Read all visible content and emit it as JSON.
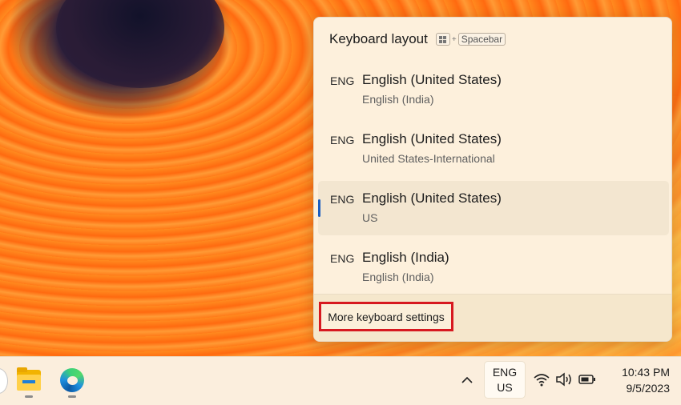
{
  "flyout": {
    "title": "Keyboard layout",
    "shortcut_plus": "+",
    "shortcut_key": "Spacebar",
    "layouts": [
      {
        "code": "ENG",
        "name": "English (United States)",
        "sub": "English (India)",
        "selected": false
      },
      {
        "code": "ENG",
        "name": "English (United States)",
        "sub": "United States-International",
        "selected": false
      },
      {
        "code": "ENG",
        "name": "English (United States)",
        "sub": "US",
        "selected": true
      },
      {
        "code": "ENG",
        "name": "English (India)",
        "sub": "English (India)",
        "selected": false
      }
    ],
    "more_settings_label": "More keyboard settings"
  },
  "taskbar": {
    "apps": [
      {
        "name": "file-explorer",
        "icon": "folder-icon"
      },
      {
        "name": "microsoft-edge",
        "icon": "edge-icon"
      }
    ],
    "lang_line1": "ENG",
    "lang_line2": "US",
    "tray_icons": [
      "wifi-icon",
      "volume-icon",
      "battery-icon"
    ],
    "time": "10:43 PM",
    "date": "9/5/2023"
  },
  "colors": {
    "highlight_border": "#d71920",
    "selection_indicator": "#1b5fc1",
    "flyout_bg": "#fdf0dc"
  }
}
